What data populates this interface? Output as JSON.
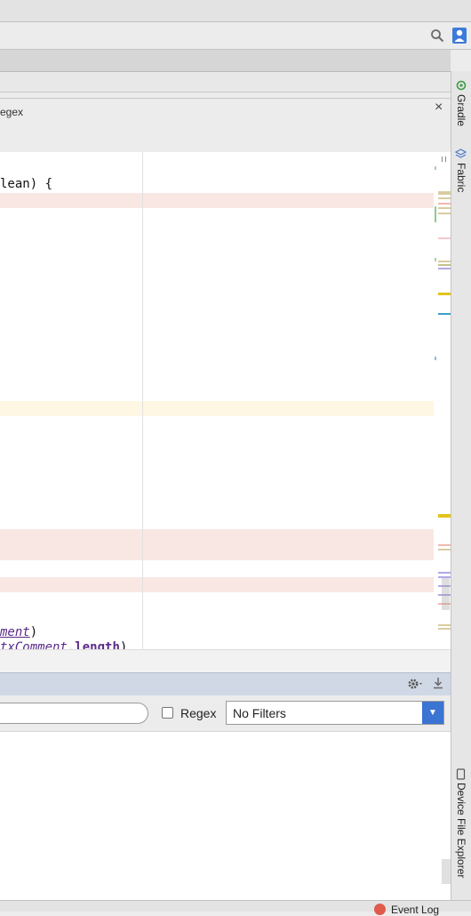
{
  "find_panel": {
    "regex_partial_label": "egex",
    "close_glyph": "×"
  },
  "editor": {
    "line_1": "lean) {",
    "line_2_text": "ment",
    "line_2_close": ")",
    "line_3_italic": "txComment",
    "line_3_dot": ".",
    "line_3_bold": "length",
    "line_3_close": ")"
  },
  "logcat": {
    "regex_label": "Regex",
    "filter_value": "No Filters",
    "settings_icon": "gear-icon",
    "download_icon": "download-icon"
  },
  "right_strip": {
    "gradle_label": "Gradle",
    "fabric_label": "Fabric",
    "device_explorer_label": "Device File Explorer"
  },
  "statusbar": {
    "event_log_label": "Event Log"
  },
  "icons": {
    "search": "search-icon",
    "user": "user-icon"
  },
  "colors": {
    "error_highlight": "#f9e7e4",
    "warning_highlight": "#fdf7e3",
    "marker_yellow": "#e3c41a",
    "marker_blue": "#3aa0c9",
    "accent_blue": "#3b74d2"
  }
}
